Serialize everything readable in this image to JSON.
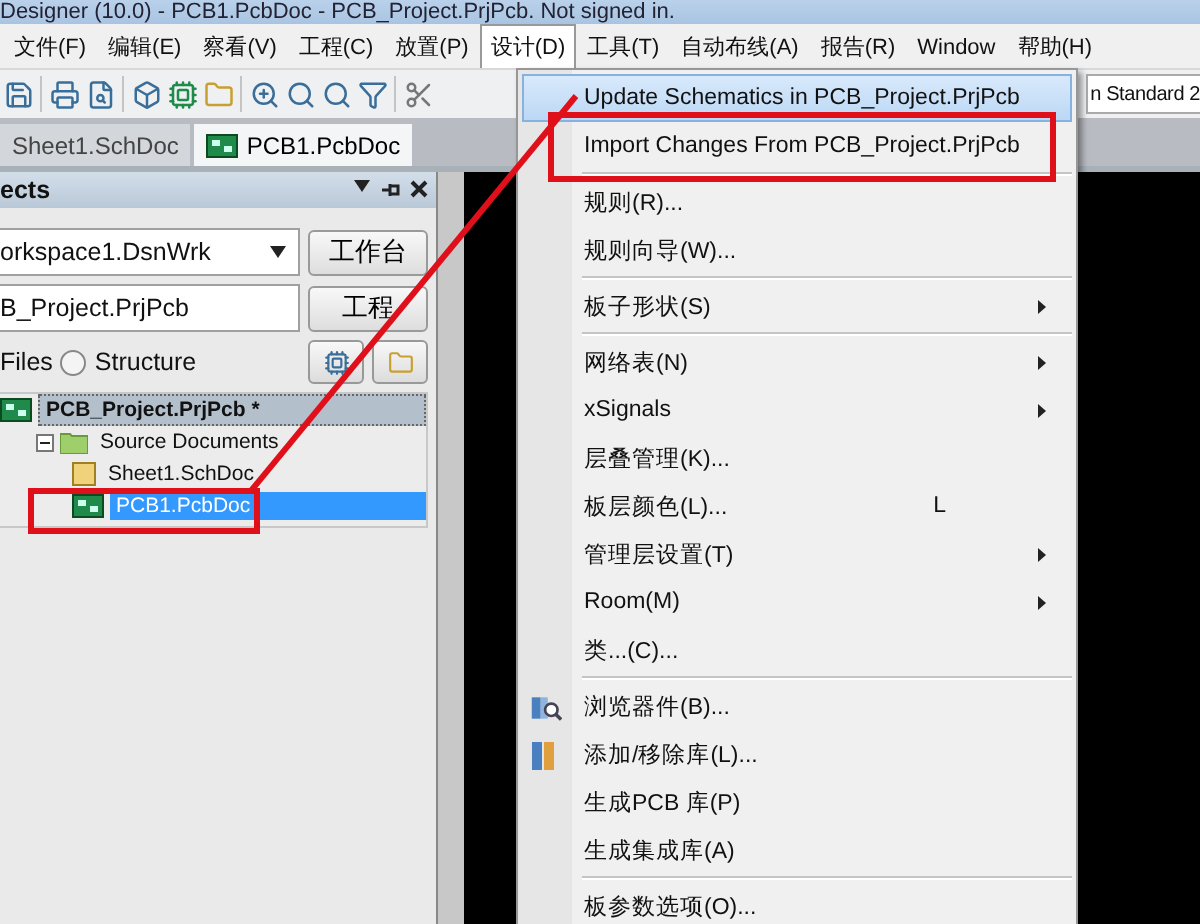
{
  "window": {
    "title": "Designer (10.0) - PCB1.PcbDoc - PCB_Project.PrjPcb. Not signed in."
  },
  "menu_bar": [
    {
      "label": "文件(F)",
      "selected": false
    },
    {
      "label": "编辑(E)",
      "selected": false
    },
    {
      "label": "察看(V)",
      "selected": false
    },
    {
      "label": "工程(C)",
      "selected": false
    },
    {
      "label": "放置(P)",
      "selected": false
    },
    {
      "label": "设计(D)",
      "selected": true
    },
    {
      "label": "工具(T)",
      "selected": false
    },
    {
      "label": "自动布线(A)",
      "selected": false
    },
    {
      "label": "报告(R)",
      "selected": false
    },
    {
      "label": "Window",
      "selected": false
    },
    {
      "label": "帮助(H)",
      "selected": false
    }
  ],
  "toolbar": {
    "dropdown_value": "n Standard 2"
  },
  "doc_tabs": [
    {
      "label": "Sheet1.SchDoc",
      "selected": false
    },
    {
      "label": "PCB1.PcbDoc",
      "selected": true
    }
  ],
  "projects_panel": {
    "title": "ects",
    "workspace": "orkspace1.DsnWrk",
    "workspace_button": "工作台",
    "project": "B_Project.PrjPcb",
    "project_button": "工程",
    "files_label": "Files",
    "structure_option": {
      "label": "Structure",
      "selected": false
    },
    "tree": [
      {
        "label": "PCB_Project.PrjPcb *",
        "kind": "project",
        "selected": false,
        "children": [
          {
            "label": "Source Documents",
            "kind": "folder",
            "selected": false,
            "expanded": true,
            "children": [
              {
                "label": "Sheet1.SchDoc",
                "kind": "schematic",
                "selected": false
              },
              {
                "label": "PCB1.PcbDoc",
                "kind": "pcb",
                "selected": true,
                "annotated": true
              }
            ]
          }
        ]
      }
    ]
  },
  "design_menu": [
    {
      "kind": "item",
      "label": "Update Schematics in PCB_Project.PrjPcb",
      "selected": true
    },
    {
      "kind": "item",
      "label": "Import Changes From PCB_Project.PrjPcb",
      "selected": false,
      "annotated": true
    },
    {
      "kind": "separator"
    },
    {
      "kind": "item",
      "label": "规则(R)...",
      "selected": false
    },
    {
      "kind": "item",
      "label": "规则向导(W)...",
      "selected": false
    },
    {
      "kind": "separator"
    },
    {
      "kind": "item",
      "label": "板子形状(S)",
      "selected": false,
      "submenu": true
    },
    {
      "kind": "separator"
    },
    {
      "kind": "item",
      "label": "网络表(N)",
      "selected": false,
      "submenu": true
    },
    {
      "kind": "item",
      "label": "xSignals",
      "selected": false,
      "submenu": true
    },
    {
      "kind": "item",
      "label": "层叠管理(K)...",
      "selected": false
    },
    {
      "kind": "item",
      "label": "板层颜色(L)...",
      "selected": false,
      "shortcut": "L"
    },
    {
      "kind": "item",
      "label": "管理层设置(T)",
      "selected": false,
      "submenu": true
    },
    {
      "kind": "item",
      "label": "Room(M)",
      "selected": false,
      "submenu": true
    },
    {
      "kind": "item",
      "label": "类...(C)...",
      "selected": false
    },
    {
      "kind": "separator"
    },
    {
      "kind": "icon_item",
      "label": "浏览器件(B)...",
      "selected": false
    },
    {
      "kind": "icon_item",
      "label": "添加/移除库(L)...",
      "selected": false
    },
    {
      "kind": "item",
      "label": "生成PCB 库(P)",
      "selected": false
    },
    {
      "kind": "item",
      "label": "生成集成库(A)",
      "selected": false
    },
    {
      "kind": "separator"
    },
    {
      "kind": "item",
      "label": "板参数选项(O)...",
      "selected": false
    }
  ]
}
